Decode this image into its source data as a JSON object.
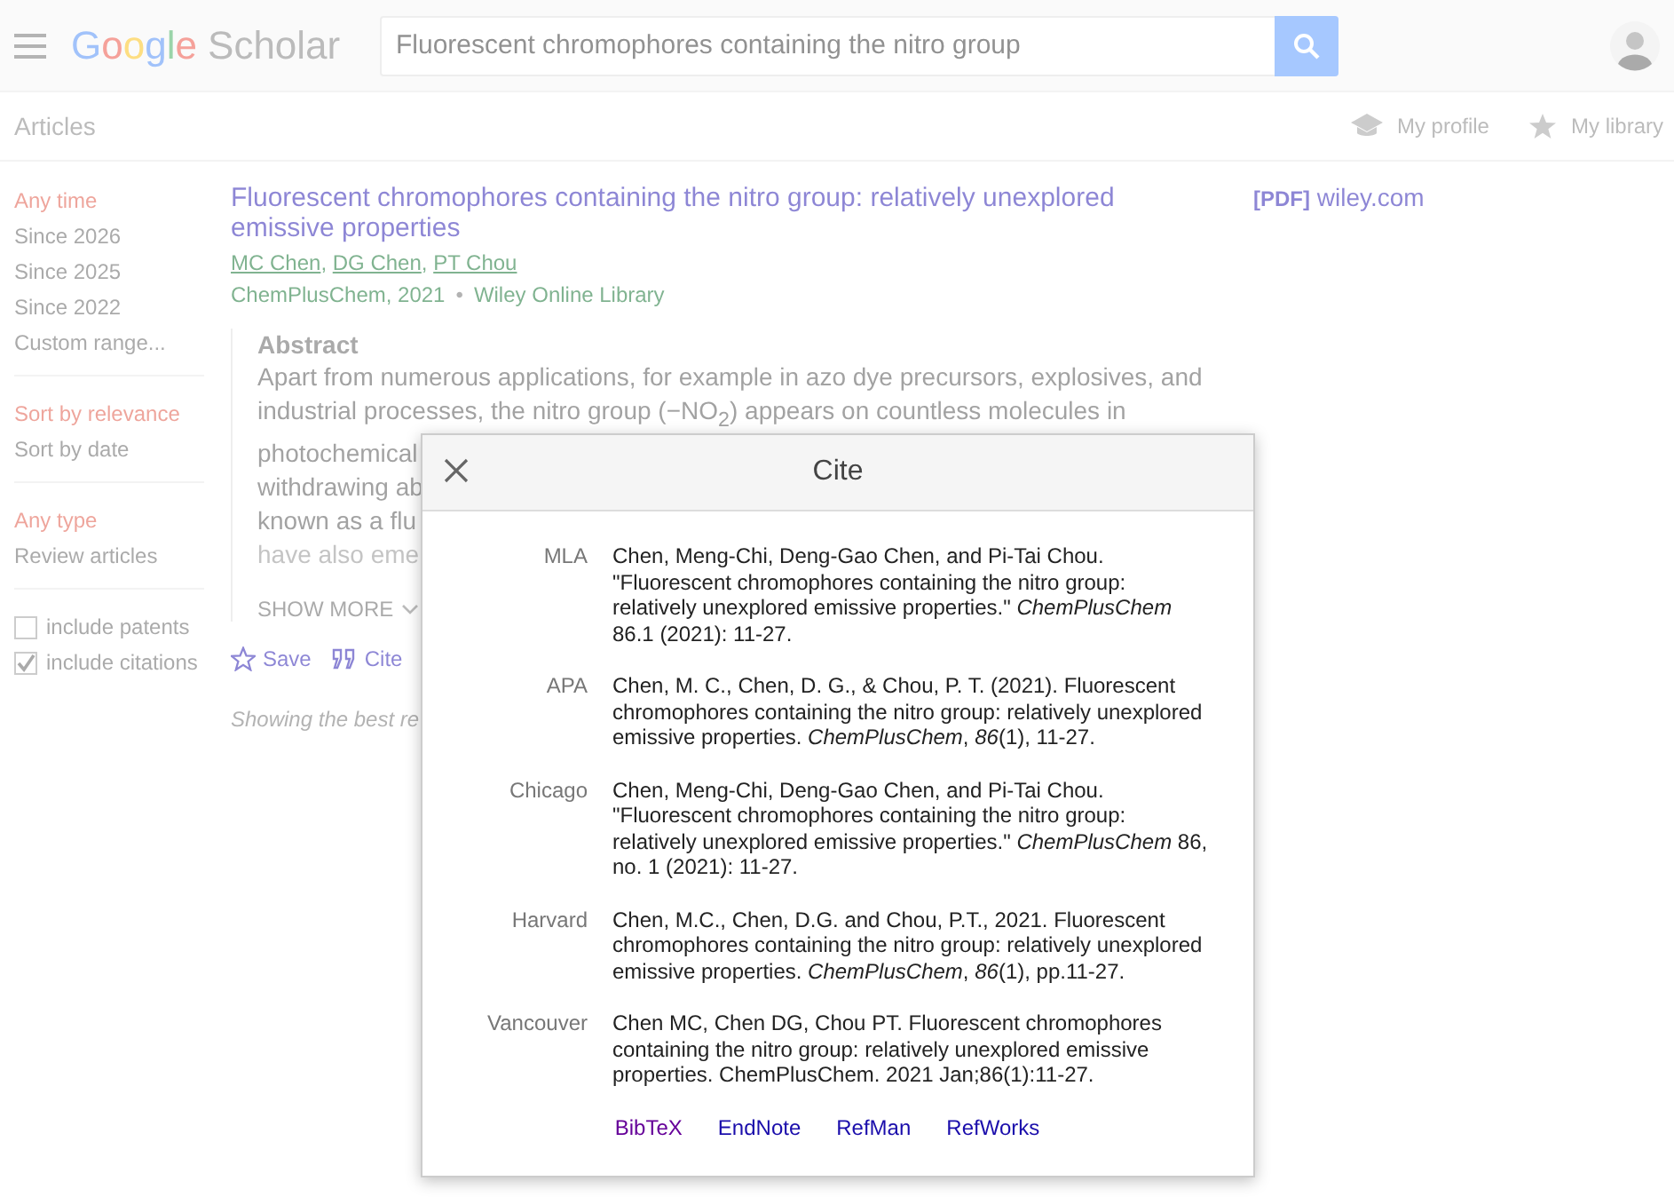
{
  "header": {
    "logo": {
      "brand": "Google",
      "product": "Scholar"
    },
    "search": {
      "value": "Fluorescent chromophores containing the nitro group"
    }
  },
  "subbar": {
    "title": "Articles",
    "links": [
      {
        "label": "My profile"
      },
      {
        "label": "My library"
      }
    ]
  },
  "sidebar": {
    "groups": [
      {
        "items": [
          {
            "label": "Any time",
            "selected": true
          },
          {
            "label": "Since 2026",
            "selected": false
          },
          {
            "label": "Since 2025",
            "selected": false
          },
          {
            "label": "Since 2022",
            "selected": false
          },
          {
            "label": "Custom range...",
            "selected": false
          }
        ]
      },
      {
        "items": [
          {
            "label": "Sort by relevance",
            "selected": true
          },
          {
            "label": "Sort by date",
            "selected": false
          }
        ]
      },
      {
        "items": [
          {
            "label": "Any type",
            "selected": true
          },
          {
            "label": "Review articles",
            "selected": false
          }
        ]
      }
    ],
    "checkboxes": [
      {
        "label": "include patents",
        "checked": false
      },
      {
        "label": "include citations",
        "checked": true
      }
    ]
  },
  "result": {
    "title": "Fluorescent chromophores containing the nitro group: relatively unexplored emissive properties",
    "authors": [
      "MC Chen",
      "DG Chen",
      "PT Chou"
    ],
    "author_separator": ",",
    "source": "ChemPlusChem, 2021",
    "source_separator": "•",
    "publisher": "Wiley Online Library",
    "abstract_heading": "Abstract",
    "abstract_lines": [
      "Apart from numerous applications, for example in azo dye precursors, explosives, and",
      "industrial processes, the nitro group (−NO$_{2}$) appears on countless molecules in",
      "photochemical",
      "withdrawing ab",
      "known as a flu",
      "have also eme"
    ],
    "show_more": "SHOW MORE",
    "actions": [
      {
        "label": "Save"
      },
      {
        "label": "Cite"
      }
    ],
    "pdf": {
      "tag": "[PDF]",
      "domain": "wiley.com"
    }
  },
  "footer_note": "Showing the best re",
  "cite_dialog": {
    "title": "Cite",
    "citations": [
      {
        "style": "MLA",
        "text": "Chen, Meng-Chi, Deng-Gao Chen, and Pi-Tai Chou. \"Fluorescent chromophores containing the nitro group: relatively unexplored emissive properties.\" *ChemPlusChem* 86.1 (2021): 11-27."
      },
      {
        "style": "APA",
        "text": "Chen, M. C., Chen, D. G., & Chou, P. T. (2021). Fluorescent chromophores containing the nitro group: relatively unexplored emissive properties. *ChemPlusChem*, *86*(1), 11-27."
      },
      {
        "style": "Chicago",
        "text": "Chen, Meng-Chi, Deng-Gao Chen, and Pi-Tai Chou. \"Fluorescent chromophores containing the nitro group: relatively unexplored emissive properties.\" *ChemPlusChem* 86, no. 1 (2021): 11-27."
      },
      {
        "style": "Harvard",
        "text": "Chen, M.C., Chen, D.G. and Chou, P.T., 2021. Fluorescent chromophores containing the nitro group: relatively unexplored emissive properties. *ChemPlusChem*, *86*(1), pp.11-27."
      },
      {
        "style": "Vancouver",
        "text": "Chen MC, Chen DG, Chou PT. Fluorescent chromophores containing the nitro group: relatively unexplored emissive properties. ChemPlusChem. 2021 Jan;86(1):11-27."
      }
    ],
    "exports": [
      {
        "label": "BibTeX",
        "visited": true
      },
      {
        "label": "EndNote",
        "visited": false
      },
      {
        "label": "RefMan",
        "visited": false
      },
      {
        "label": "RefWorks",
        "visited": false
      }
    ]
  }
}
